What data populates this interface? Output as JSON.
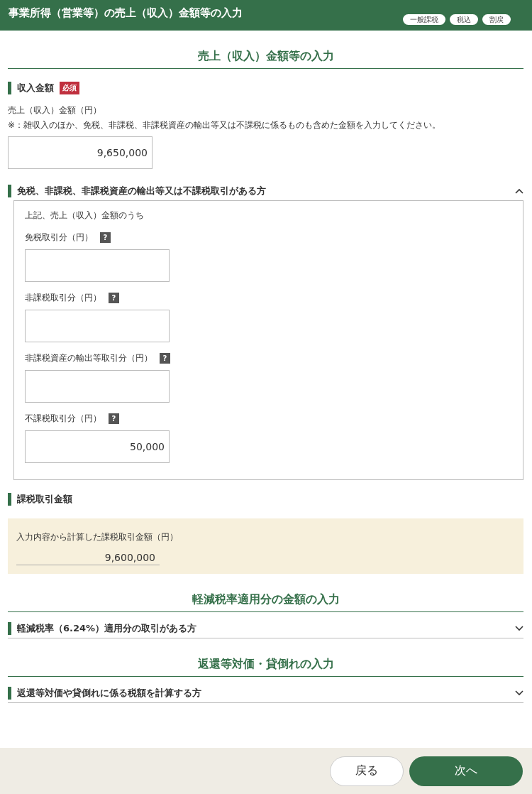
{
  "header": {
    "title": "事業所得（営業等）の売上（収入）金額等の入力",
    "tags": [
      "一般課税",
      "税込",
      "割戻"
    ]
  },
  "page_title": "売上（収入）金額等の入力",
  "income": {
    "heading": "収入金額",
    "required_badge": "必須",
    "label": "売上（収入）金額（円）",
    "note": "※：雑収入のほか、免税、非課税、非課税資産の輸出等又は不課税に係るものも含めた金額を入力してください。",
    "value": "9,650,000"
  },
  "exempt": {
    "title": "免税、非課税、非課税資産の輸出等又は不課税取引がある方",
    "expanded": true,
    "intro": "上記、売上（収入）金額のうち",
    "fields": [
      {
        "label": "免税取引分（円）",
        "help": "?"
      },
      {
        "label": "非課税取引分（円）",
        "help": "?"
      },
      {
        "label": "非課税資産の輸出等取引分（円）",
        "help": "?"
      },
      {
        "label": "不課税取引分（円）",
        "help": "?",
        "value": "50,000"
      }
    ]
  },
  "taxable": {
    "heading": "課税取引金額",
    "label": "入力内容から計算した課税取引金額（円）",
    "value": "9,600,000"
  },
  "sections": [
    {
      "title": "軽減税率適用分の金額の入力",
      "accordion": {
        "title": "軽減税率（6.24%）適用分の取引がある方",
        "expanded": false
      }
    },
    {
      "title": "返還等対価・貸倒れの入力",
      "accordion": {
        "title": "返還等対価や貸倒れに係る税額を計算する方",
        "expanded": false
      }
    }
  ],
  "footer": {
    "back": "戻る",
    "next": "次へ"
  }
}
